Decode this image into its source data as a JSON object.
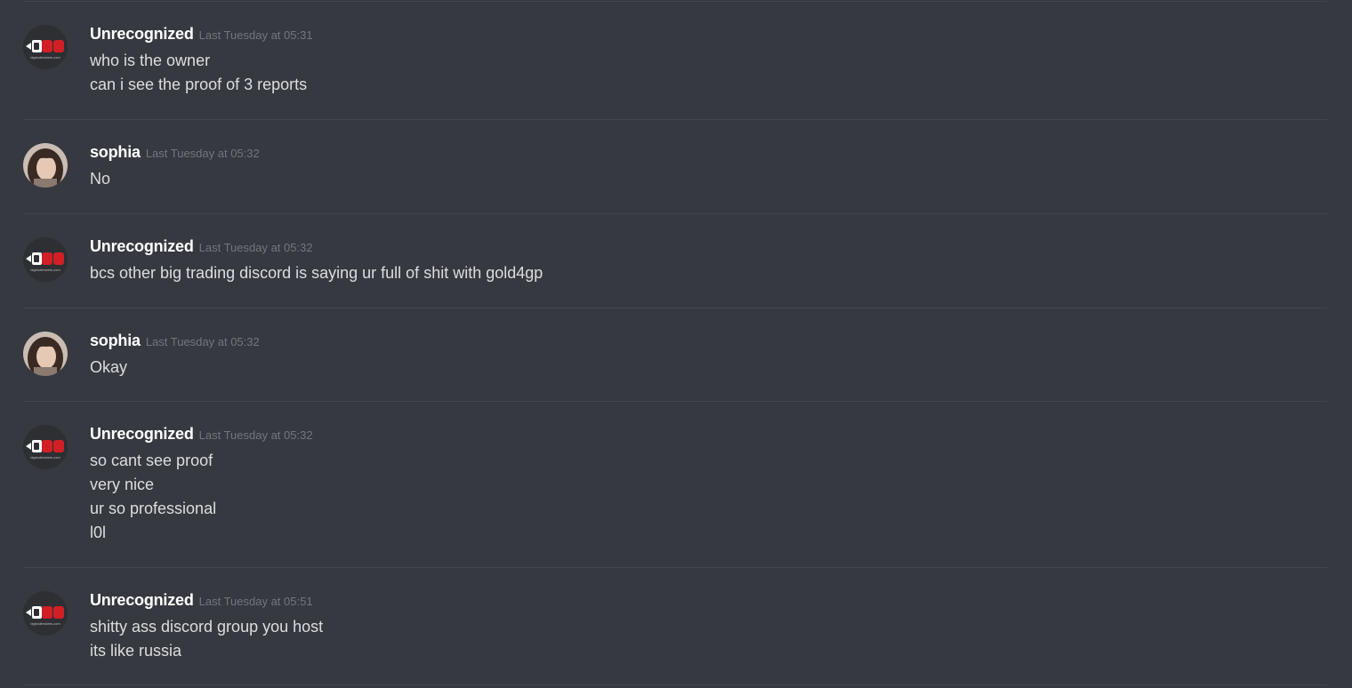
{
  "messages": [
    {
      "author": "Unrecognized",
      "avatar_icon": "bigbodiesbets-logo-icon",
      "avatar_text": "bigbodiesbets.com",
      "timestamp": "Last Tuesday at 05:31",
      "lines": [
        "who is the owner",
        "can i see the proof of 3 reports"
      ]
    },
    {
      "author": "sophia",
      "avatar_icon": "user-photo-avatar",
      "timestamp": "Last Tuesday at 05:32",
      "lines": [
        "No"
      ]
    },
    {
      "author": "Unrecognized",
      "avatar_icon": "bigbodiesbets-logo-icon",
      "avatar_text": "bigbodiesbets.com",
      "timestamp": "Last Tuesday at 05:32",
      "lines": [
        "bcs other big trading discord is saying ur full of shit with gold4gp"
      ]
    },
    {
      "author": "sophia",
      "avatar_icon": "user-photo-avatar",
      "timestamp": "Last Tuesday at 05:32",
      "lines": [
        "Okay"
      ]
    },
    {
      "author": "Unrecognized",
      "avatar_icon": "bigbodiesbets-logo-icon",
      "avatar_text": "bigbodiesbets.com",
      "timestamp": "Last Tuesday at 05:32",
      "lines": [
        "so cant see proof",
        "very nice",
        "ur so professional",
        "l0l"
      ]
    },
    {
      "author": "Unrecognized",
      "avatar_icon": "bigbodiesbets-logo-icon",
      "avatar_text": "bigbodiesbets.com",
      "timestamp": "Last Tuesday at 05:51",
      "lines": [
        "shitty ass discord group you host",
        "its like russia"
      ]
    }
  ],
  "colors": {
    "background": "#36393f",
    "divider": "#42454b",
    "username": "#ffffff",
    "timestamp": "#72767d",
    "message_text": "#dcddde",
    "logo_red": "#d11f26"
  }
}
